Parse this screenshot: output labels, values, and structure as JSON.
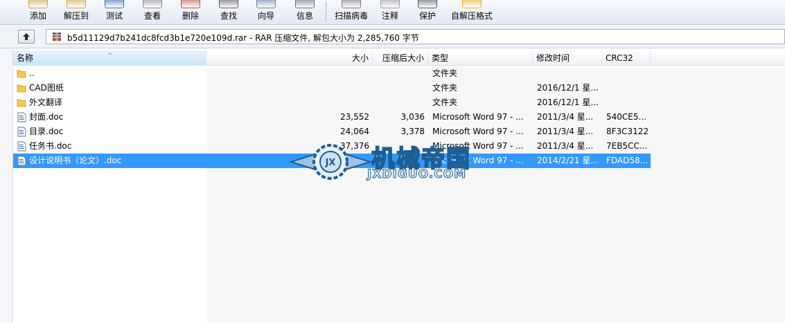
{
  "toolbar": {
    "buttons": [
      {
        "label": "添加",
        "icon": "add-icon",
        "color": "#c9a24a"
      },
      {
        "label": "解压到",
        "icon": "extract-icon",
        "color": "#d4a13b"
      },
      {
        "label": "测试",
        "icon": "test-icon",
        "color": "#3b6db5"
      },
      {
        "label": "查看",
        "icon": "view-icon",
        "color": "#8a8a8a"
      },
      {
        "label": "删除",
        "icon": "delete-icon",
        "color": "#b7524a"
      },
      {
        "label": "查找",
        "icon": "find-icon",
        "color": "#5a5a5a"
      },
      {
        "label": "向导",
        "icon": "wizard-icon",
        "color": "#6b7fa6"
      },
      {
        "label": "信息",
        "icon": "info-icon",
        "color": "#5a6f8f"
      },
      {
        "label": "扫描病毒",
        "icon": "scan-virus-icon",
        "color": "#7a7a7a"
      },
      {
        "label": "注释",
        "icon": "comment-icon",
        "color": "#999999"
      },
      {
        "label": "保护",
        "icon": "protect-icon",
        "color": "#4a5a6a"
      },
      {
        "label": "自解压格式",
        "icon": "sfx-icon",
        "color": "#e0b21e"
      }
    ]
  },
  "address": {
    "text": "b5d11129d7b241dc8fcd3b1e720e109d.rar - RAR 压缩文件, 解包大小为 2,285,760 字节"
  },
  "columns": {
    "name": "名称",
    "size": "大小",
    "packed": "压缩后大小",
    "type": "类型",
    "modified": "修改时间",
    "crc": "CRC32"
  },
  "files": [
    {
      "name": "..",
      "size": "",
      "packed": "",
      "type": "文件夹",
      "modified": "",
      "crc": "",
      "kind": "folder"
    },
    {
      "name": "CAD图纸",
      "size": "",
      "packed": "",
      "type": "文件夹",
      "modified": "2016/12/1 星...",
      "crc": "",
      "kind": "folder"
    },
    {
      "name": "外文翻译",
      "size": "",
      "packed": "",
      "type": "文件夹",
      "modified": "2016/12/1 星...",
      "crc": "",
      "kind": "folder"
    },
    {
      "name": "封面.doc",
      "size": "23,552",
      "packed": "3,036",
      "type": "Microsoft Word 97 - ...",
      "modified": "2011/3/4 星...",
      "crc": "540CE5...",
      "kind": "doc"
    },
    {
      "name": "目录.doc",
      "size": "24,064",
      "packed": "3,378",
      "type": "Microsoft Word 97 - ...",
      "modified": "2011/3/4 星...",
      "crc": "8F3C3122",
      "kind": "doc"
    },
    {
      "name": "任务书.doc",
      "size": "37,376",
      "packed": "",
      "type": "Microsoft Word 97 - ...",
      "modified": "2011/3/4 星...",
      "crc": "7EB5CC...",
      "kind": "doc"
    },
    {
      "name": "设计说明书（论文）.doc",
      "size": "",
      "packed": "",
      "type": "Microsoft Word 97 - ...",
      "modified": "2014/2/21 星...",
      "crc": "FDAD58...",
      "kind": "doc",
      "selected": true
    }
  ],
  "watermark": {
    "cn": "机械帝国",
    "en": "JXDIGUO.COM",
    "logo_text": "JX"
  },
  "colors": {
    "selection": "#3399ff",
    "watermark_blue": "#1c5f94"
  }
}
